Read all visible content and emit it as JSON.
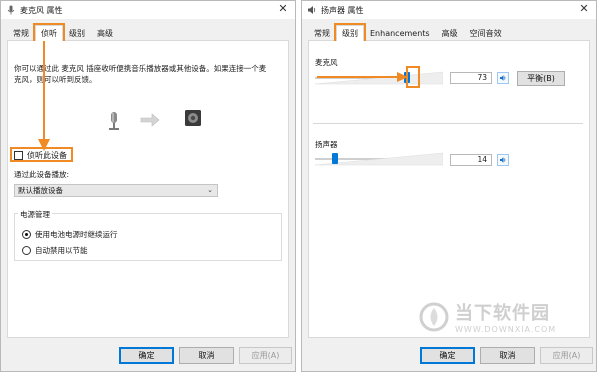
{
  "left_window": {
    "title": "麦克风 属性",
    "close_glyph": "✕",
    "tabs": [
      {
        "label": "常规"
      },
      {
        "label": "侦听"
      },
      {
        "label": "级别"
      },
      {
        "label": "高级"
      }
    ],
    "active_tab": "侦听",
    "description_line1": "你可以通过此 麦克风 插座收听便携音乐播放器或其他设备。如果连接一个麦",
    "description_line2": "克风，则可以听到反馈。",
    "listen_checkbox_label": "侦听此设备",
    "listen_checkbox_checked": false,
    "playback_label": "通过此设备播放:",
    "playback_select_value": "默认播放设备",
    "power_group_title": "电源管理",
    "power_options": [
      {
        "label": "使用电池电源时继续运行",
        "selected": true
      },
      {
        "label": "自动禁用以节能",
        "selected": false
      }
    ],
    "buttons": {
      "ok": "确定",
      "cancel": "取消",
      "apply": "应用(A)"
    }
  },
  "right_window": {
    "title": "扬声器 属性",
    "close_glyph": "✕",
    "tabs": [
      {
        "label": "常规"
      },
      {
        "label": "级别"
      },
      {
        "label": "Enhancements"
      },
      {
        "label": "高级"
      },
      {
        "label": "空间音效"
      }
    ],
    "active_tab": "级别",
    "levels": [
      {
        "name": "麦克风",
        "value": "73",
        "level": 73,
        "has_balance": true
      },
      {
        "name": "扬声器",
        "value": "14",
        "level": 14,
        "has_balance": false
      }
    ],
    "balance_label": "平衡(B)",
    "buttons": {
      "ok": "确定",
      "cancel": "取消",
      "apply": "应用(A)"
    }
  },
  "watermark": {
    "text": "当下软件园",
    "sub": "WWW.DOWNXIA.COM"
  },
  "colors": {
    "accent_blue": "#0078d7",
    "annotation_orange": "#f08a24"
  },
  "icons": [
    "microphone-icon",
    "speaker-icon",
    "arrow-right-icon",
    "speaker-volume-icon"
  ]
}
